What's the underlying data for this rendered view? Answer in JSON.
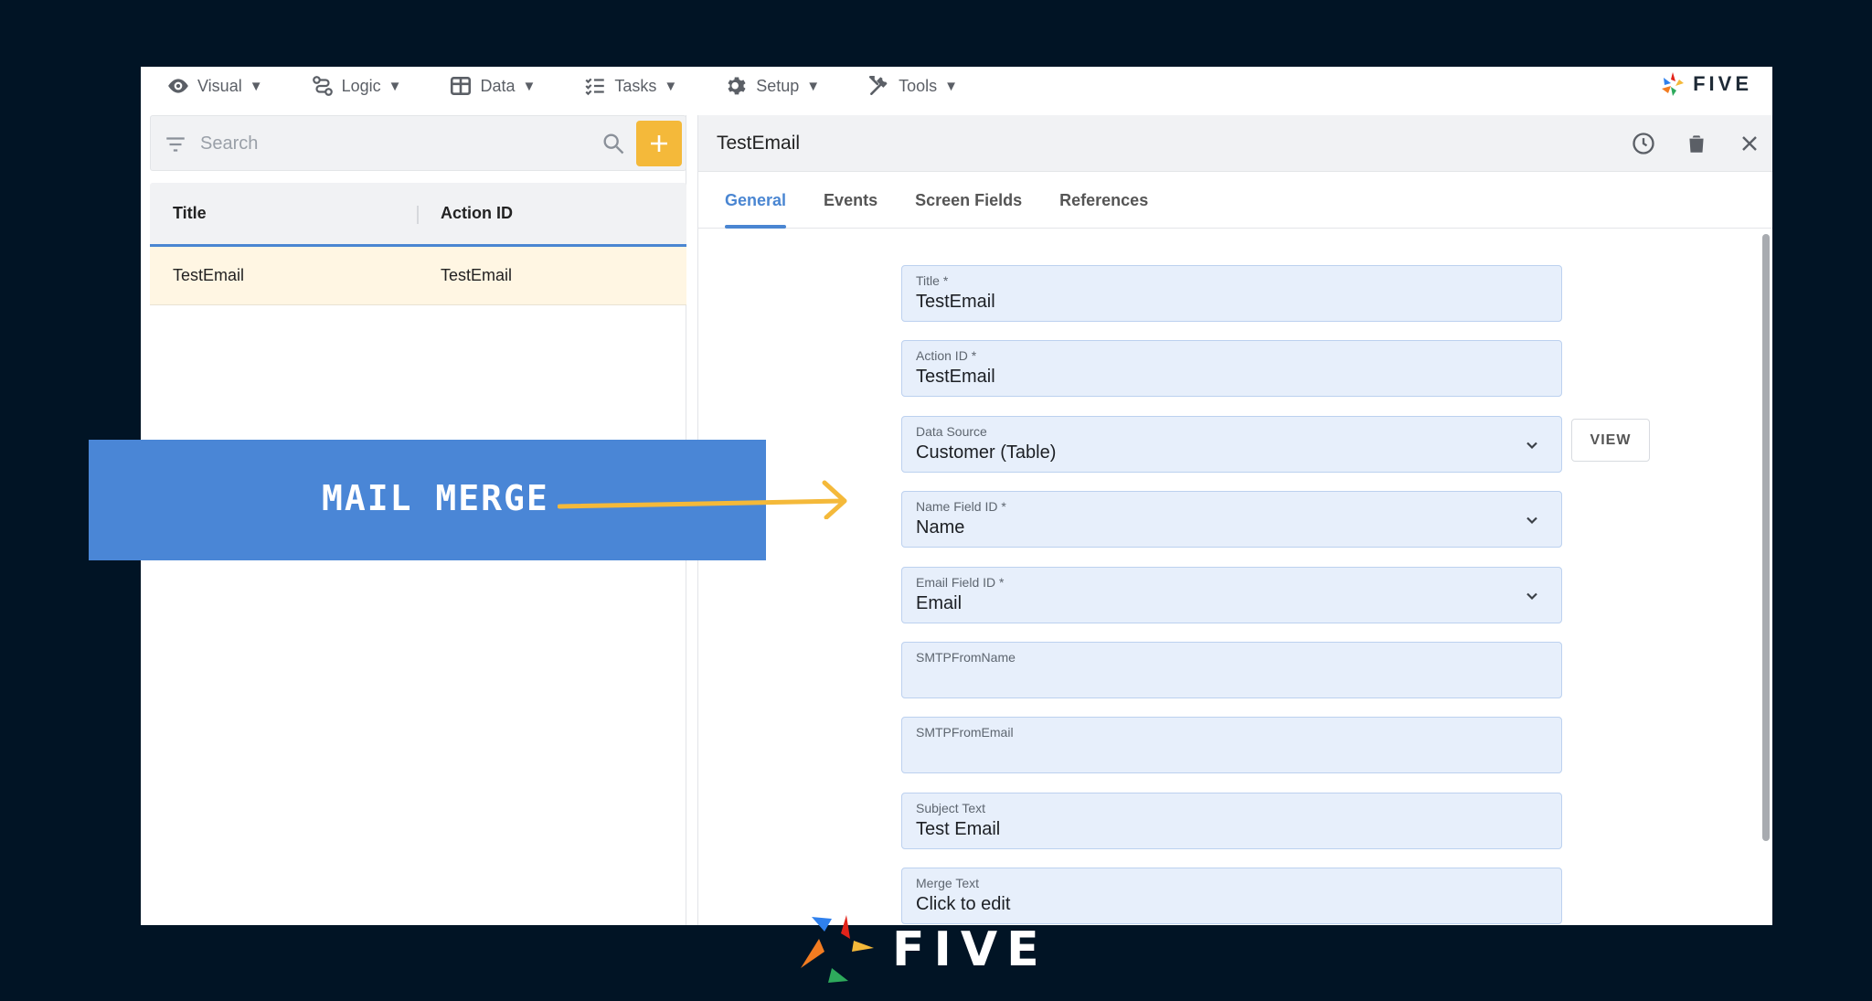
{
  "menubar": {
    "items": [
      {
        "label": "Visual",
        "icon": "eye-icon"
      },
      {
        "label": "Logic",
        "icon": "flow-icon"
      },
      {
        "label": "Data",
        "icon": "table-icon"
      },
      {
        "label": "Tasks",
        "icon": "checklist-icon"
      },
      {
        "label": "Setup",
        "icon": "gear-icon"
      },
      {
        "label": "Tools",
        "icon": "tools-icon"
      }
    ],
    "caret": "▼",
    "brand": "FIVE"
  },
  "search": {
    "placeholder": "Search"
  },
  "table": {
    "columns": [
      "Title",
      "Action ID"
    ],
    "rows": [
      [
        "TestEmail",
        "TestEmail"
      ]
    ]
  },
  "record": {
    "title": "TestEmail",
    "tabs": [
      "General",
      "Events",
      "Screen Fields",
      "References"
    ],
    "active_tab": "General",
    "fields": [
      {
        "label": "Title *",
        "value": "TestEmail",
        "dropdown": false
      },
      {
        "label": "Action ID *",
        "value": "TestEmail",
        "dropdown": false
      },
      {
        "label": "Data Source",
        "value": "Customer (Table)",
        "dropdown": true
      },
      {
        "label": "Name Field ID *",
        "value": "Name",
        "dropdown": true
      },
      {
        "label": "Email Field ID *",
        "value": "Email",
        "dropdown": true
      },
      {
        "label": "SMTPFromName",
        "value": "",
        "dropdown": false
      },
      {
        "label": "SMTPFromEmail",
        "value": "",
        "dropdown": false
      },
      {
        "label": "Subject Text",
        "value": "Test Email",
        "dropdown": false
      },
      {
        "label": "Merge Text",
        "value": "Click to edit",
        "dropdown": false
      }
    ],
    "view_button": "VIEW"
  },
  "overlay": {
    "banner_text": "MAIL MERGE"
  },
  "footer": {
    "brand": "FIVE"
  },
  "colors": {
    "accent": "#4a86d2",
    "add_button": "#f4b93a",
    "arrow": "#f4b93a",
    "background": "#011425"
  }
}
